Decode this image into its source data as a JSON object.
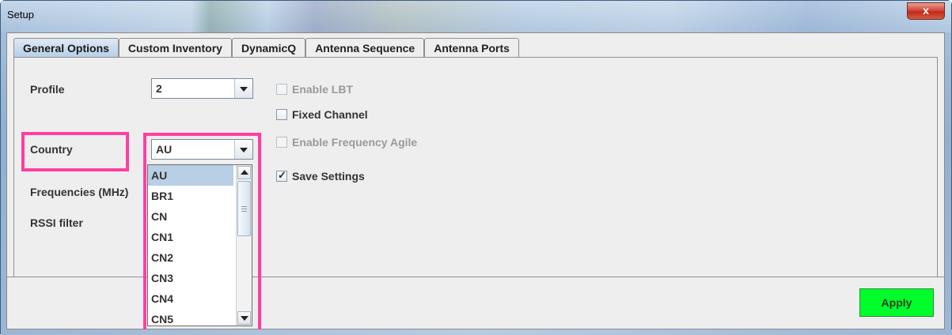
{
  "window": {
    "title": "Setup",
    "close_glyph": "x"
  },
  "tabs": [
    {
      "label": "General Options",
      "active": true
    },
    {
      "label": "Custom Inventory",
      "active": false
    },
    {
      "label": "DynamicQ",
      "active": false
    },
    {
      "label": "Antenna Sequence",
      "active": false
    },
    {
      "label": "Antenna Ports",
      "active": false
    }
  ],
  "form": {
    "profile_label": "Profile",
    "profile_value": "2",
    "country_label": "Country",
    "country_value": "AU",
    "frequencies_label": "Frequencies (MHz)",
    "rssi_label": "RSSI filter"
  },
  "checkboxes": {
    "enable_lbt": {
      "label": "Enable LBT",
      "checked": false,
      "enabled": false
    },
    "fixed_channel": {
      "label": "Fixed Channel",
      "checked": false,
      "enabled": true
    },
    "enable_freq_agile": {
      "label": "Enable Frequency Agile",
      "checked": false,
      "enabled": false
    },
    "save_settings": {
      "label": "Save Settings",
      "checked": true,
      "enabled": true
    }
  },
  "country_options": [
    "AU",
    "BR1",
    "CN",
    "CN1",
    "CN2",
    "CN3",
    "CN4",
    "CN5"
  ],
  "country_selected": "AU",
  "apply_label": "Apply",
  "colors": {
    "highlight": "#ff3fa0",
    "apply_bg": "#00ff2a",
    "selected_bg": "#b8cfe5"
  },
  "icons": {
    "dropdown_arrow": "chevron-down-icon",
    "checkmark": "checkmark-icon",
    "close": "close-icon"
  }
}
